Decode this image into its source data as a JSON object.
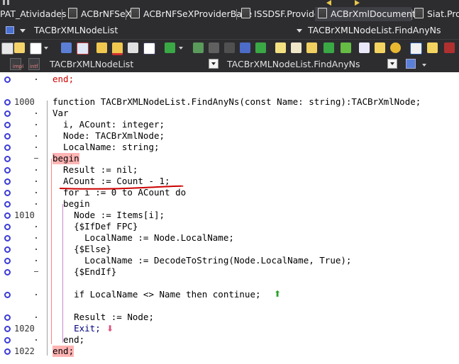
{
  "tabs": [
    {
      "label": "PAT_Atividades",
      "active": false
    },
    {
      "label": "ACBrNFSeX",
      "active": false
    },
    {
      "label": "ACBrNFSeXProviderBase",
      "active": false
    },
    {
      "label": "ISSDSF.Provider",
      "active": false
    },
    {
      "label": "ACBrXmlDocument",
      "active": true
    },
    {
      "label": "Siat.Provi",
      "active": false
    }
  ],
  "breadcrumb": {
    "left": "TACBrXMLNodeList",
    "right": "TACBrXMLNodeList.FindAnyNs"
  },
  "combos": {
    "class_combo": "TACBrXMLNodeList",
    "method_combo": "TACBrXMLNodeList.FindAnyNs"
  },
  "toolbar": {
    "icons": [
      "new-icon",
      "save-icon",
      "save-all-icon",
      "close-icon",
      "open-project-icon",
      "remove-icon",
      "build-icon",
      "run-icon",
      "step-icon",
      "trace-icon",
      "run-to-cursor-icon",
      "breakpoint-icon",
      "bookmark-icon",
      "watch-icon",
      "evaluate-icon",
      "help-icon",
      "settings-icon",
      "info-icon"
    ],
    "labels": {
      "impl": "impl",
      "intf": "intf"
    }
  },
  "colors": {
    "background": "#2d2d30",
    "editor": "#ffffff",
    "begin_highlight": "#ffb3b3",
    "word_highlight": "#c9c9f9",
    "annotation_underline": "#cc0000"
  },
  "editor": {
    "lines": [
      {
        "num": "",
        "marker": "dot",
        "text": "end;"
      },
      {
        "num": "",
        "marker": "",
        "text": ""
      },
      {
        "num": "1000",
        "marker": "num",
        "text": "function TACBrXMLNodeList.FindAnyNs(const Name: string):TACBrXmlNode;"
      },
      {
        "num": "",
        "marker": "dot",
        "text": "Var"
      },
      {
        "num": "",
        "marker": "dot",
        "text": "  i, ACount: integer;"
      },
      {
        "num": "",
        "marker": "dot",
        "text": "  Node: TACBrXmlNode;"
      },
      {
        "num": "",
        "marker": "dot",
        "text": "  LocalName: string;"
      },
      {
        "num": "",
        "marker": "dash",
        "text": "begin"
      },
      {
        "num": "",
        "marker": "dot",
        "text": "  Result := nil;"
      },
      {
        "num": "",
        "marker": "dot",
        "text": "  ACount := Count - 1;"
      },
      {
        "num": "",
        "marker": "dot",
        "text": "  for i := 0 to ACount do"
      },
      {
        "num": "",
        "marker": "dot",
        "text": "  begin"
      },
      {
        "num": "1010",
        "marker": "num",
        "text": "    Node := Items[i];"
      },
      {
        "num": "",
        "marker": "dot",
        "text": "    {$IfDef FPC}"
      },
      {
        "num": "",
        "marker": "dot",
        "text": "      LocalName := Node.LocalName;"
      },
      {
        "num": "",
        "marker": "dot",
        "text": "    {$Else}"
      },
      {
        "num": "",
        "marker": "dot",
        "text": "      LocalName := DecodeToString(Node.LocalName, True);"
      },
      {
        "num": "",
        "marker": "dash",
        "text": "    {$EndIf}"
      },
      {
        "num": "",
        "marker": "",
        "text": ""
      },
      {
        "num": "",
        "marker": "dot",
        "text": "    if LocalName <> Name then continue;"
      },
      {
        "num": "",
        "marker": "",
        "text": ""
      },
      {
        "num": "",
        "marker": "dot",
        "text": "    Result := Node;"
      },
      {
        "num": "1020",
        "marker": "num",
        "text": "    Exit;"
      },
      {
        "num": "",
        "marker": "dot",
        "text": "  end;"
      },
      {
        "num": "1022",
        "marker": "num",
        "text": "end;"
      }
    ]
  }
}
